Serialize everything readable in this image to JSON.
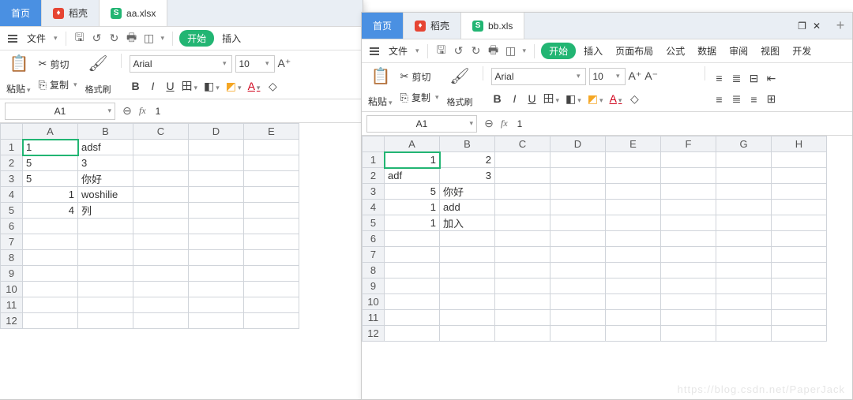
{
  "left": {
    "tabs": {
      "home": "首页",
      "doke": "稻壳",
      "file": "aa.xlsx"
    },
    "menubar": {
      "file": "文件",
      "start": "开始",
      "insert": "插入"
    },
    "ribbon": {
      "paste": "粘贴",
      "cut": "剪切",
      "copy": "复制",
      "format": "格式刷",
      "font": "Arial",
      "size": "10"
    },
    "namebox": "A1",
    "formula": "1",
    "columns": [
      "A",
      "B",
      "C",
      "D",
      "E"
    ],
    "rows": [
      "1",
      "2",
      "3",
      "4",
      "5",
      "6",
      "7",
      "8",
      "9",
      "10",
      "11",
      "12"
    ],
    "cells": {
      "A1": "1",
      "B1": "adsf",
      "A2": "5",
      "B2": "3",
      "A3": "5",
      "B3": "你好",
      "A4": "1",
      "B4": "woshilie",
      "A5": "4",
      "B5": "列"
    }
  },
  "right": {
    "tabs": {
      "home": "首页",
      "doke": "稻壳",
      "file": "bb.xls"
    },
    "menubar": {
      "file": "文件",
      "start": "开始",
      "insert": "插入",
      "layout": "页面布局",
      "formula": "公式",
      "data": "数据",
      "review": "审阅",
      "view": "视图",
      "dev": "开发"
    },
    "ribbon": {
      "paste": "粘贴",
      "cut": "剪切",
      "copy": "复制",
      "format": "格式刷",
      "font": "Arial",
      "size": "10"
    },
    "namebox": "A1",
    "formula": "1",
    "columns": [
      "A",
      "B",
      "C",
      "D",
      "E",
      "F",
      "G",
      "H"
    ],
    "rows": [
      "1",
      "2",
      "3",
      "4",
      "5",
      "6",
      "7",
      "8",
      "9",
      "10",
      "11",
      "12"
    ],
    "cells": {
      "A1": "1",
      "B1": "2",
      "A2": "adf",
      "B2": "3",
      "A3": "5",
      "B3": "你好",
      "A4": "1",
      "B4": "add",
      "A5": "1",
      "B5": "加入"
    }
  },
  "watermark": "https://blog.csdn.net/PaperJack"
}
